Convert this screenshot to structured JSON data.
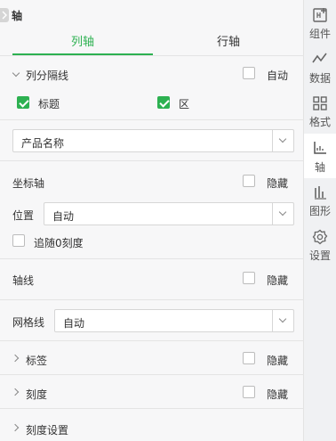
{
  "panel": {
    "title": "轴",
    "tabs": [
      {
        "label": "列轴",
        "active": true
      },
      {
        "label": "行轴",
        "active": false
      }
    ]
  },
  "column_separator": {
    "label": "列分隔线",
    "auto_label": "自动",
    "auto_checked": false,
    "title_label": "标题",
    "title_checked": true,
    "area_label": "区",
    "area_checked": true
  },
  "field_select": {
    "value": "产品名称"
  },
  "coordinate_axis": {
    "label": "坐标轴",
    "hide_label": "隐藏",
    "hide_checked": false,
    "position_label": "位置",
    "position_value": "自动",
    "follow_zero_label": "追随0刻度",
    "follow_zero_checked": false
  },
  "axis_line": {
    "label": "轴线",
    "hide_label": "隐藏",
    "hide_checked": false
  },
  "grid_line": {
    "label": "网格线",
    "value": "自动"
  },
  "labels_section": {
    "label": "标签",
    "hide_label": "隐藏",
    "hide_checked": false
  },
  "ticks_section": {
    "label": "刻度",
    "hide_label": "隐藏",
    "hide_checked": false
  },
  "tick_settings": {
    "label": "刻度设置"
  },
  "sidebar": {
    "items": [
      {
        "label": "组件",
        "icon": "component-icon"
      },
      {
        "label": "数据",
        "icon": "data-icon"
      },
      {
        "label": "格式",
        "icon": "format-icon"
      },
      {
        "label": "轴",
        "icon": "axis-icon",
        "active": true
      },
      {
        "label": "图形",
        "icon": "graphic-icon"
      },
      {
        "label": "设置",
        "icon": "settings-icon"
      }
    ]
  },
  "colors": {
    "accent": "#2db151"
  }
}
